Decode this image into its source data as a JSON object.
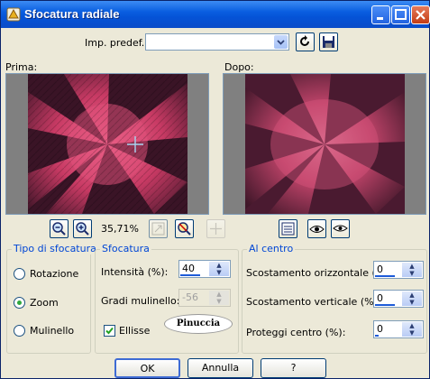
{
  "window": {
    "title": "Sfocatura radiale",
    "buttons": [
      "minimize-icon",
      "maximize-icon",
      "close-icon"
    ]
  },
  "preset": {
    "label": "Imp. predef.:",
    "value": ""
  },
  "preview": {
    "before_label": "Prima:",
    "after_label": "Dopo:",
    "zoom": "35,71%"
  },
  "tipo": {
    "title": "Tipo di sfocatura",
    "options": [
      "Rotazione",
      "Zoom",
      "Mulinello"
    ],
    "selected": "Zoom"
  },
  "sfocatura": {
    "title": "Sfocatura",
    "intensity_label": "Intensità (%):",
    "intensity_value": "40",
    "twist_label": "Gradi mulinello:",
    "twist_value": "-56",
    "ellipse_label": "Ellisse",
    "ellipse_checked": true,
    "logo_text": "Pinuccia"
  },
  "center": {
    "title": "Al centro",
    "h_label": "Scostamento orizzontale (%):",
    "h_value": "0",
    "v_label": "Scostamento verticale (%):",
    "v_value": "0",
    "protect_label": "Proteggi centro (%):",
    "protect_value": "0"
  },
  "actions": {
    "ok": "OK",
    "cancel": "Annulla",
    "help": "?"
  },
  "colors": {
    "titlebar": "#0553d7",
    "dialog_bg": "#ece9d8",
    "group_title": "#0046d5",
    "image_pink": "#e0507a"
  }
}
